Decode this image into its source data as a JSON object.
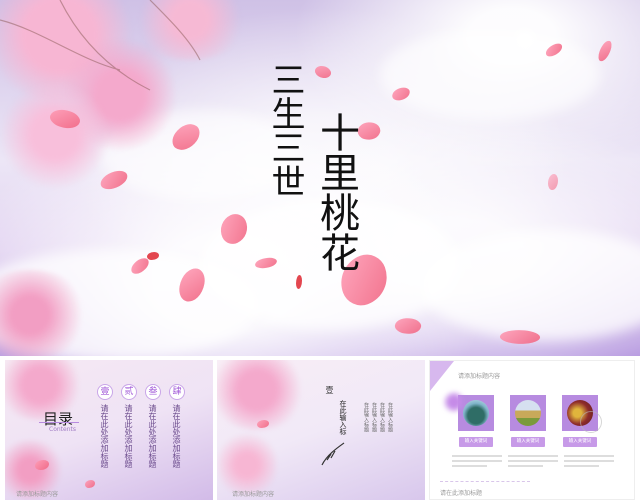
{
  "hero": {
    "title_part1": "三生三世",
    "title_part2": "十里桃花"
  },
  "thumb1": {
    "toc_title": "目录",
    "toc_subtitle": "Contents",
    "badges": [
      "壹",
      "贰",
      "叁",
      "肆"
    ],
    "items": [
      "请在此处添加标题",
      "请在此处添加标题",
      "请在此处添加标题",
      "请在此处添加标题"
    ]
  },
  "thumb2": {
    "numeral": "壹",
    "heading": "在此输入标",
    "lines": [
      "在此输入标题",
      "在此输入标题",
      "在此输入标题",
      "在此输入标题"
    ]
  },
  "thumb3": {
    "header_label": "请添加标题内容",
    "buttons": [
      "输入关键词",
      "输入关键词",
      "输入关键词"
    ],
    "footer_label": "请在此添加标题"
  },
  "bottom_strip": {
    "left_label": "请添加标题内容",
    "middle_label": "请添加标题内容"
  },
  "colors": {
    "accent": "#b78be0",
    "petal": "#f0627f"
  }
}
